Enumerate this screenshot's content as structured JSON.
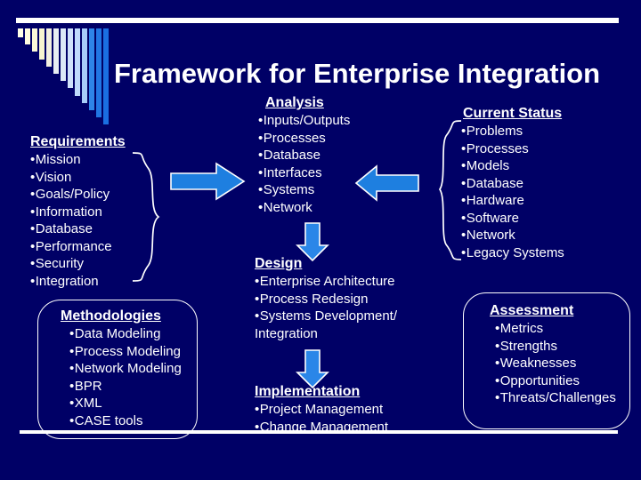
{
  "slide": {
    "title": "Framework for Enterprise Integration",
    "background_color": "#000066",
    "accent_color": "#1E7FE0",
    "text_color": "#FFFFFF"
  },
  "decor": {
    "top_rule": "horizontal-rule",
    "bottom_rule": "horizontal-rule",
    "bar_colors": [
      "#FFFFE8",
      "#FFFDE0",
      "#FBF9D8",
      "#F7F5D0",
      "#F2F0E0",
      "#E8EEF2",
      "#DCE9F6",
      "#CFE2FA",
      "#BFDAFB",
      "#A8CEF8",
      "#2E84E8",
      "#2176E4",
      "#1A6EE2"
    ]
  },
  "requirements": {
    "heading": "Requirements",
    "items": [
      "Mission",
      "Vision",
      "Goals/Policy",
      "Information",
      "Database",
      "Performance",
      "Security",
      "Integration"
    ]
  },
  "analysis": {
    "heading": "Analysis",
    "items": [
      "Inputs/Outputs",
      "Processes",
      "Database",
      "Interfaces",
      "Systems",
      "Network"
    ]
  },
  "current_status": {
    "heading": "Current Status",
    "items": [
      "Problems",
      "Processes",
      "Models",
      "Database",
      "Hardware",
      "Software",
      "Network",
      "Legacy Systems"
    ]
  },
  "methodologies": {
    "heading": "Methodologies",
    "items": [
      "Data Modeling",
      "Process Modeling",
      "Network Modeling",
      "BPR",
      "XML",
      "CASE tools"
    ]
  },
  "design": {
    "heading": "Design",
    "items": [
      "Enterprise Architecture",
      "Process Redesign",
      "Systems Development/"
    ],
    "continuation": "Integration"
  },
  "implementation": {
    "heading": "Implementation",
    "items": [
      "Project Management",
      "Change Management"
    ]
  },
  "assessment": {
    "heading": "Assessment",
    "items": [
      "Metrics",
      "Strengths",
      "Weaknesses",
      "Opportunities",
      "Threats/Challenges"
    ]
  },
  "arrows": {
    "requirements_to_analysis": "arrow-right-icon",
    "status_to_analysis": "arrow-left-icon",
    "analysis_to_design": "arrow-down-icon",
    "design_to_implementation": "arrow-down-icon"
  },
  "braces": {
    "requirements_brace": "curly-brace-right-icon",
    "status_brace": "curly-brace-left-icon"
  },
  "bullet": "•"
}
